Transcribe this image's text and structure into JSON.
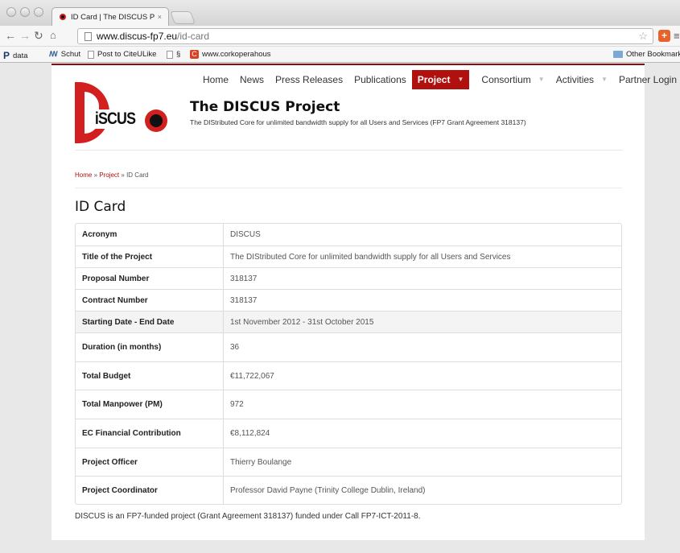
{
  "browser": {
    "tab": {
      "title": "ID Card | The DISCUS Proj",
      "close": "×"
    },
    "url_domain": "www.discus-fp7.eu",
    "url_path": "/id-card",
    "bookmarks": [
      {
        "label": "data",
        "icon": "p-icon"
      },
      {
        "label": "Schut",
        "icon": "schut-icon"
      },
      {
        "label": "Post to CiteULike",
        "icon": "page-icon"
      },
      {
        "label": "§",
        "icon": "page-icon"
      },
      {
        "label": "www.corkoperahous",
        "icon": "citeulike-icon"
      }
    ],
    "other_bookmarks": "Other Bookmarks"
  },
  "nav": {
    "items": [
      {
        "label": "Home"
      },
      {
        "label": "News"
      },
      {
        "label": "Press Releases"
      },
      {
        "label": "Publications"
      },
      {
        "label": "Project",
        "active": true,
        "dropdown": true
      },
      {
        "label": "Consortium",
        "dropdown": true
      },
      {
        "label": "Activities",
        "dropdown": true
      },
      {
        "label": "Partner Login"
      }
    ]
  },
  "site": {
    "logo_text": "iSCUS",
    "title": "The DISCUS Project",
    "subtitle": "The DIStributed Core for unlimited bandwidth supply for all Users and Services (FP7 Grant Agreement 318137)"
  },
  "breadcrumb": {
    "home": "Home",
    "sep1": " » ",
    "project": "Project",
    "sep2": " » ",
    "current": "ID Card"
  },
  "heading": "ID Card",
  "id_card": [
    {
      "key": "Acronym",
      "value": "DISCUS"
    },
    {
      "key": "Title of the Project",
      "value": "The DIStributed Core for unlimited bandwidth supply for all Users and Services"
    },
    {
      "key": "Proposal Number",
      "value": "318137"
    },
    {
      "key": "Contract Number",
      "value": "318137"
    },
    {
      "key": "Starting Date - End Date",
      "value": "1st November 2012 - 31st October 2015"
    },
    {
      "key": "Duration (in months)",
      "value": "36"
    },
    {
      "key": "Total Budget",
      "value": "€11,722,067"
    },
    {
      "key": "Total Manpower (PM)",
      "value": "972"
    },
    {
      "key": "EC Financial Contribution",
      "value": "€8,112,824"
    },
    {
      "key": "Project Officer",
      "value": "Thierry Boulange"
    },
    {
      "key": "Project Coordinator",
      "value": "Professor David Payne (Trinity College Dublin, Ireland)"
    }
  ],
  "footnote": "DISCUS is an FP7-funded project (Grant Agreement 318137) funded under Call FP7-ICT-2011-8.",
  "colors": {
    "accent": "#b0100e",
    "logo_red": "#d21f1f"
  }
}
